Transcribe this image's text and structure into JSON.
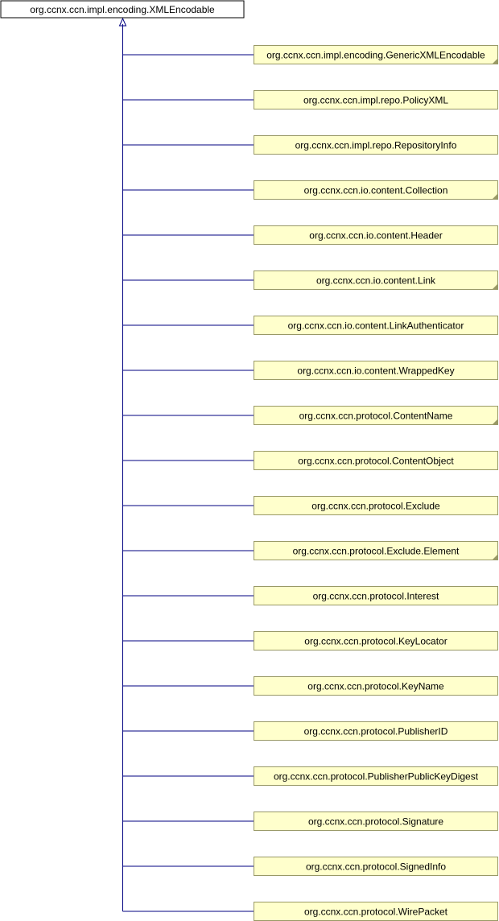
{
  "diagram": {
    "root": {
      "label": "org.ccnx.ccn.impl.encoding.XMLEncodable",
      "folded": false
    },
    "children": [
      {
        "label": "org.ccnx.ccn.impl.encoding.GenericXMLEncodable",
        "folded": true
      },
      {
        "label": "org.ccnx.ccn.impl.repo.PolicyXML",
        "folded": false
      },
      {
        "label": "org.ccnx.ccn.impl.repo.RepositoryInfo",
        "folded": false
      },
      {
        "label": "org.ccnx.ccn.io.content.Collection",
        "folded": true
      },
      {
        "label": "org.ccnx.ccn.io.content.Header",
        "folded": false
      },
      {
        "label": "org.ccnx.ccn.io.content.Link",
        "folded": true
      },
      {
        "label": "org.ccnx.ccn.io.content.LinkAuthenticator",
        "folded": false
      },
      {
        "label": "org.ccnx.ccn.io.content.WrappedKey",
        "folded": false
      },
      {
        "label": "org.ccnx.ccn.protocol.ContentName",
        "folded": true
      },
      {
        "label": "org.ccnx.ccn.protocol.ContentObject",
        "folded": false
      },
      {
        "label": "org.ccnx.ccn.protocol.Exclude",
        "folded": false
      },
      {
        "label": "org.ccnx.ccn.protocol.Exclude.Element",
        "folded": true
      },
      {
        "label": "org.ccnx.ccn.protocol.Interest",
        "folded": false
      },
      {
        "label": "org.ccnx.ccn.protocol.KeyLocator",
        "folded": false
      },
      {
        "label": "org.ccnx.ccn.protocol.KeyName",
        "folded": false
      },
      {
        "label": "org.ccnx.ccn.protocol.PublisherID",
        "folded": false
      },
      {
        "label": "org.ccnx.ccn.protocol.PublisherPublicKeyDigest",
        "folded": false
      },
      {
        "label": "org.ccnx.ccn.protocol.Signature",
        "folded": false
      },
      {
        "label": "org.ccnx.ccn.protocol.SignedInfo",
        "folded": false
      },
      {
        "label": "org.ccnx.ccn.protocol.WirePacket",
        "folded": false
      }
    ],
    "colors": {
      "root_fill": "#ffffff",
      "root_stroke": "#000000",
      "child_fill": "#ffffcc",
      "child_stroke": "#999966",
      "edge": "#000080",
      "fold_corner": "#999966"
    }
  }
}
